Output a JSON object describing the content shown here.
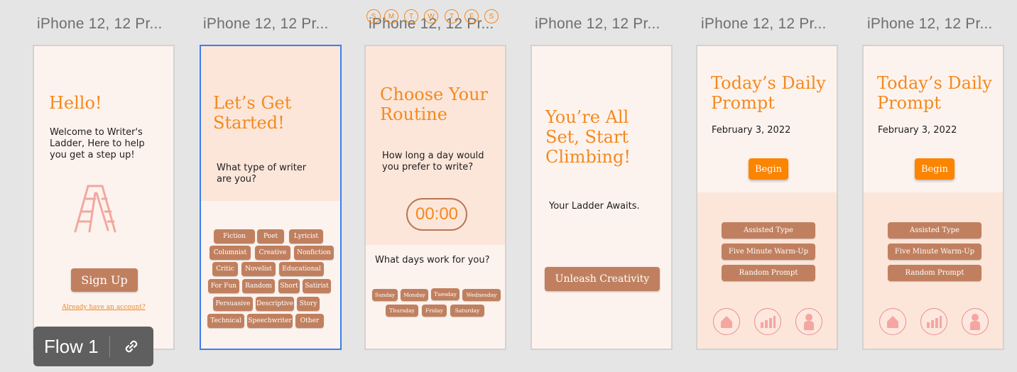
{
  "frames": {
    "titles": [
      "iPhone 12, 12 Pr...",
      "iPhone 12, 12 Pr...",
      "iPhone 12, 12 Pr...",
      "iPhone 12, 12 Pr...",
      "iPhone 12, 12 Pr...",
      "iPhone 12, 12 Pr..."
    ]
  },
  "screen1": {
    "heading": "Hello!",
    "welcome": "Welcome to Writer's Ladder, Here to help you get a step up!",
    "signup": "Sign Up",
    "login_link": "Already have an account?"
  },
  "screen2": {
    "heading": "Let’s Get Started!",
    "question": "What type of writer are you?",
    "chips": [
      "Fiction",
      "Poet",
      "Lyricist",
      "Columnist",
      "Creative",
      "Nonfiction",
      "Critic",
      "Novelist",
      "Educational",
      "For Fun",
      "Random",
      "Short",
      "Satirist",
      "Persuasive",
      "Descriptive",
      "Story",
      "Technical",
      "Speechwriter",
      "Other"
    ]
  },
  "screen3": {
    "weekday_letters": [
      "S",
      "M",
      "T",
      "W",
      "T",
      "F",
      "S"
    ],
    "heading": "Choose Your Routine",
    "question": "How long a day would you prefer to write?",
    "timer": "00:00",
    "days_question": "What days work for you?",
    "days": [
      "Sunday",
      "Monday",
      "Tuesday",
      "Wednesday",
      "Thursday",
      "Friday",
      "Saturday"
    ]
  },
  "screen4": {
    "heading": "You’re All Set, Start Climbing!",
    "subtitle": "Your Ladder Awaits.",
    "cta": "Unleash Creativity"
  },
  "screen5": {
    "heading": "Today’s Daily Prompt",
    "date": "February 3, 2022",
    "begin": "Begin",
    "options": [
      "Assisted Type",
      "Five Minute Warm-Up",
      "Random Prompt"
    ]
  },
  "screen6": {
    "heading": "Today’s Daily Prompt",
    "date": "February 3, 2022",
    "begin": "Begin",
    "options": [
      "Assisted Type",
      "Five Minute Warm-Up",
      "Random Prompt"
    ]
  },
  "nav_icons": [
    "home-icon",
    "stats-icon",
    "profile-icon"
  ],
  "flow": {
    "label": "Flow 1",
    "link_icon": "link-icon"
  },
  "colors": {
    "canvas": "#e5e5e5",
    "accent_orange": "#f4891f",
    "button_orange": "#fb8400",
    "chip_brown": "#c0805f",
    "peach": "#fce6da",
    "cream": "#fdf3ee",
    "selection_blue": "#3b7ef0"
  }
}
